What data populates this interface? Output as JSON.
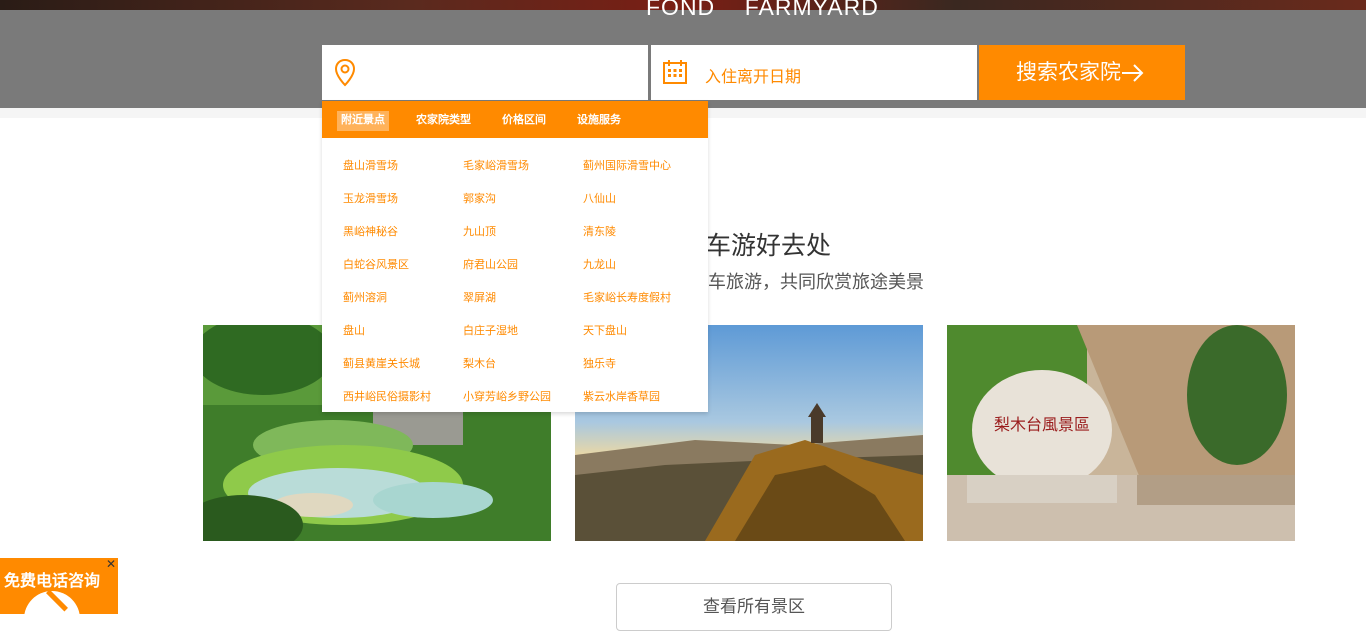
{
  "hero": {
    "title": "FOND    FARMYARD"
  },
  "search": {
    "date_placeholder": "入住离开日期",
    "button_label": "搜索农家院",
    "location_icon": "location-pin-icon",
    "calendar_icon": "calendar-icon",
    "arrow_icon": "arrow-right-icon"
  },
  "section": {
    "headline": "车游好去处",
    "subline": "车旅游，共同欣赏旅途美景"
  },
  "dropdown": {
    "tabs": [
      "附近景点",
      "农家院类型",
      "价格区间",
      "设施服务"
    ],
    "active_tab": "附近景点",
    "items": [
      [
        "盘山滑雪场",
        "毛家峪滑雪场",
        "蓟州国际滑雪中心"
      ],
      [
        "玉龙滑雪场",
        "郭家沟",
        "八仙山"
      ],
      [
        "黑峪神秘谷",
        "九山顶",
        "清东陵"
      ],
      [
        "白蛇谷风景区",
        "府君山公园",
        "九龙山"
      ],
      [
        "蓟州溶洞",
        "翠屏湖",
        "毛家峪长寿度假村"
      ],
      [
        "盘山",
        "白庄子湿地",
        "天下盘山"
      ],
      [
        "蓟县黄崖关长城",
        "梨木台",
        "独乐寺"
      ],
      [
        "西井峪民俗摄影村",
        "小穿芳峪乡野公园",
        "紫云水岸香草园"
      ]
    ]
  },
  "photos": [
    {
      "name": "terraced-pond-photo"
    },
    {
      "name": "mountain-pagoda-photo"
    },
    {
      "name": "limuta-stone-photo",
      "stone_text": "梨木台風景區"
    }
  ],
  "view_all": "查看所有景区",
  "phone": {
    "label": "免费电话咨询",
    "close": "✕"
  },
  "colors": {
    "accent": "#ff8a00",
    "hero_bg": "#7a7a7a"
  }
}
